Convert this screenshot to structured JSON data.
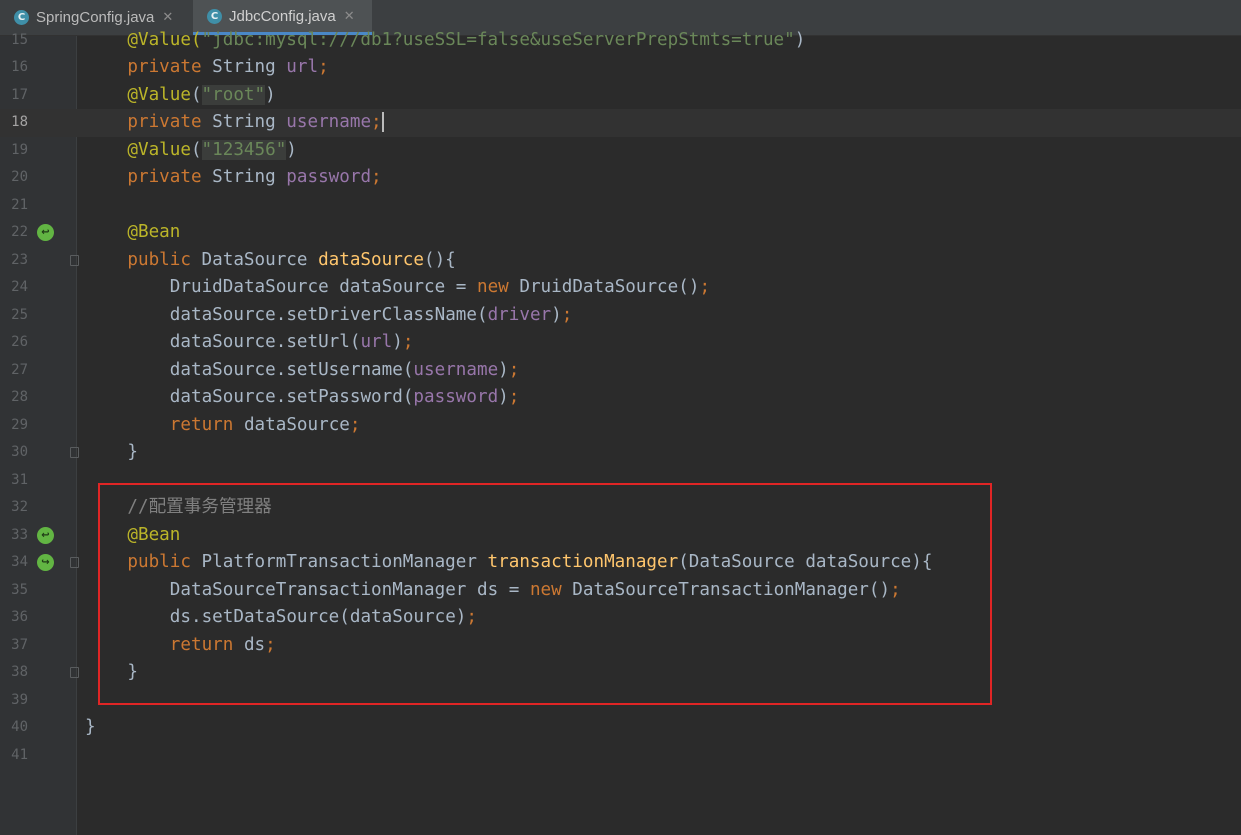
{
  "tabs": [
    {
      "label": "SpringConfig.java",
      "icon": "C",
      "active": false
    },
    {
      "label": "JdbcConfig.java",
      "icon": "C",
      "active": true
    }
  ],
  "editor": {
    "current_line": "18",
    "lines": [
      {
        "n": "15",
        "tokens": [
          {
            "t": "@Value(",
            "c": "ann"
          },
          {
            "t": "\"jdbc:mysql:///db1?useSSL=false&useServerPrepStmts=true\"",
            "c": "str"
          },
          {
            "t": ")",
            "c": ""
          }
        ]
      },
      {
        "n": "16",
        "tokens": [
          {
            "t": "private",
            "c": "kw"
          },
          {
            "t": " String ",
            "c": ""
          },
          {
            "t": "url",
            "c": "field"
          },
          {
            "t": ";",
            "c": "kw"
          }
        ]
      },
      {
        "n": "17",
        "tokens": [
          {
            "t": "@Value",
            "c": "ann"
          },
          {
            "t": "(",
            "c": ""
          },
          {
            "t": "\"root\"",
            "c": "str"
          },
          {
            "t": ")",
            "c": ""
          }
        ]
      },
      {
        "n": "18",
        "tokens": [
          {
            "t": "private",
            "c": "kw"
          },
          {
            "t": " String ",
            "c": ""
          },
          {
            "t": "username",
            "c": "field"
          },
          {
            "t": ";",
            "c": "kw"
          }
        ]
      },
      {
        "n": "19",
        "tokens": [
          {
            "t": "@Value",
            "c": "ann"
          },
          {
            "t": "(",
            "c": ""
          },
          {
            "t": "\"123456\"",
            "c": "str"
          },
          {
            "t": ")",
            "c": ""
          }
        ]
      },
      {
        "n": "20",
        "tokens": [
          {
            "t": "private",
            "c": "kw"
          },
          {
            "t": " String ",
            "c": ""
          },
          {
            "t": "password",
            "c": "field"
          },
          {
            "t": ";",
            "c": "kw"
          }
        ]
      },
      {
        "n": "21",
        "tokens": []
      },
      {
        "n": "22",
        "tokens": [
          {
            "t": "@Bean",
            "c": "ann"
          }
        ]
      },
      {
        "n": "23",
        "tokens": [
          {
            "t": "public",
            "c": "kw"
          },
          {
            "t": " DataSource ",
            "c": ""
          },
          {
            "t": "dataSource",
            "c": "fn"
          },
          {
            "t": "(){",
            "c": ""
          }
        ]
      },
      {
        "n": "24",
        "tokens": [
          {
            "t": "DruidDataSource dataSource = ",
            "c": ""
          },
          {
            "t": "new",
            "c": "kw"
          },
          {
            "t": " DruidDataSource()",
            "c": ""
          },
          {
            "t": ";",
            "c": "kw"
          }
        ]
      },
      {
        "n": "25",
        "tokens": [
          {
            "t": "dataSource.setDriverClassName(",
            "c": ""
          },
          {
            "t": "driver",
            "c": "field"
          },
          {
            "t": ")",
            "c": ""
          },
          {
            "t": ";",
            "c": "kw"
          }
        ]
      },
      {
        "n": "26",
        "tokens": [
          {
            "t": "dataSource.setUrl(",
            "c": ""
          },
          {
            "t": "url",
            "c": "field"
          },
          {
            "t": ")",
            "c": ""
          },
          {
            "t": ";",
            "c": "kw"
          }
        ]
      },
      {
        "n": "27",
        "tokens": [
          {
            "t": "dataSource.setUsername(",
            "c": ""
          },
          {
            "t": "username",
            "c": "field"
          },
          {
            "t": ")",
            "c": ""
          },
          {
            "t": ";",
            "c": "kw"
          }
        ]
      },
      {
        "n": "28",
        "tokens": [
          {
            "t": "dataSource.setPassword(",
            "c": ""
          },
          {
            "t": "password",
            "c": "field"
          },
          {
            "t": ")",
            "c": ""
          },
          {
            "t": ";",
            "c": "kw"
          }
        ]
      },
      {
        "n": "29",
        "tokens": [
          {
            "t": "return",
            "c": "kw"
          },
          {
            "t": " dataSource",
            "c": ""
          },
          {
            "t": ";",
            "c": "kw"
          }
        ]
      },
      {
        "n": "30",
        "tokens": [
          {
            "t": "}",
            "c": ""
          }
        ]
      },
      {
        "n": "31",
        "tokens": []
      },
      {
        "n": "32",
        "tokens": [
          {
            "t": "//配置事务管理器",
            "c": "cmt"
          }
        ]
      },
      {
        "n": "33",
        "tokens": [
          {
            "t": "@Bean",
            "c": "ann"
          }
        ]
      },
      {
        "n": "34",
        "tokens": [
          {
            "t": "public",
            "c": "kw"
          },
          {
            "t": " PlatformTransactionManager ",
            "c": ""
          },
          {
            "t": "transactionManager",
            "c": "fn"
          },
          {
            "t": "(DataSource dataSource){",
            "c": ""
          }
        ]
      },
      {
        "n": "35",
        "tokens": [
          {
            "t": "DataSourceTransactionManager ds = ",
            "c": ""
          },
          {
            "t": "new",
            "c": "kw"
          },
          {
            "t": " DataSourceTransactionManager()",
            "c": ""
          },
          {
            "t": ";",
            "c": "kw"
          }
        ]
      },
      {
        "n": "36",
        "tokens": [
          {
            "t": "ds.setDataSource(dataSource)",
            "c": ""
          },
          {
            "t": ";",
            "c": "kw"
          }
        ]
      },
      {
        "n": "37",
        "tokens": [
          {
            "t": "return",
            "c": "kw"
          },
          {
            "t": " ds",
            "c": ""
          },
          {
            "t": ";",
            "c": "kw"
          }
        ]
      },
      {
        "n": "38",
        "tokens": [
          {
            "t": "}",
            "c": ""
          }
        ]
      },
      {
        "n": "39",
        "tokens": []
      },
      {
        "n": "40",
        "tokens": [
          {
            "t": "}",
            "c": ""
          }
        ]
      },
      {
        "n": "41",
        "tokens": []
      }
    ]
  },
  "colors": {
    "background": "#2b2b2b",
    "gutter": "#313335",
    "keyword": "#cc7832",
    "annotation": "#bbb529",
    "string": "#6a8759",
    "field": "#9876aa",
    "method": "#ffc66d",
    "comment": "#808080",
    "highlight_box": "#e02525",
    "tab_underline": "#4a88c7"
  },
  "gutter_icons": [
    {
      "line": "22",
      "icon": "bean-run-icon"
    },
    {
      "line": "33",
      "icon": "bean-run-icon"
    },
    {
      "line": "34",
      "icon": "bean-navigate-icon"
    }
  ]
}
